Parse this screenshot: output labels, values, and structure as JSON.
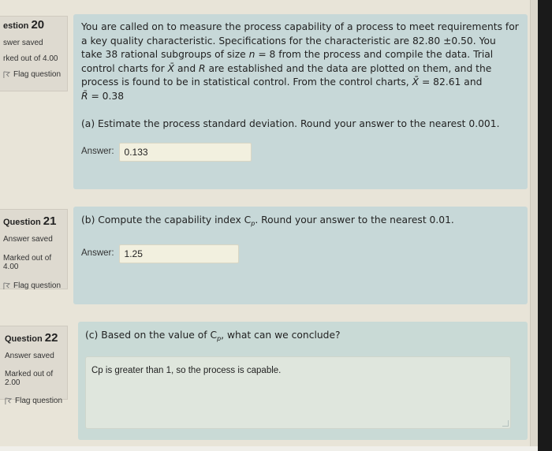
{
  "questions": [
    {
      "number": "20",
      "question_label": "estion",
      "status": "swer saved",
      "marks": "rked out of 4.00",
      "flag_label": "Flag question",
      "text_parts": {
        "p1": "You are called on to measure the process capability of a process to meet requirements for a key quality characteristic. Specifications for the characteristic are 82.80 ±0.50. You take 38 rational subgroups of size ",
        "n_var": "n",
        "p2": " = 8 from the process and compile the data. Trial control charts for ",
        "xbar_var": "X̄",
        "p3": " and ",
        "r_var": "R",
        "p4": " are established and the data are plotted on them, and the process is found to be in statistical control. From the control charts, ",
        "xbarbar_var": "X̄̄",
        "p5": " = 82.61 and",
        "rbar_var": "R̄",
        "p6": " = 0.38"
      },
      "part_a": {
        "prompt": "(a) Estimate the process standard deviation. Round your answer to the nearest 0.001.",
        "answer_label": "Answer:",
        "answer_value": "0.133"
      }
    },
    {
      "number": "21",
      "question_label": "Question",
      "status": "Answer saved",
      "marks": "Marked out of 4.00",
      "flag_label": "Flag question",
      "part_b": {
        "prompt_before": "(b) Compute the capability index C",
        "prompt_sub": "p",
        "prompt_after": ". Round your answer to the nearest 0.01.",
        "answer_label": "Answer:",
        "answer_value": "1.25"
      }
    },
    {
      "number": "22",
      "question_label": "Question",
      "status": "Answer saved",
      "marks": "Marked out of 2.00",
      "flag_label": "Flag question",
      "part_c": {
        "prompt_before": "(c) Based on the value of C",
        "prompt_sub": "p",
        "prompt_after": ", what can we conclude?",
        "answer_value": "Cp is greater than 1, so the process is capable."
      }
    }
  ]
}
